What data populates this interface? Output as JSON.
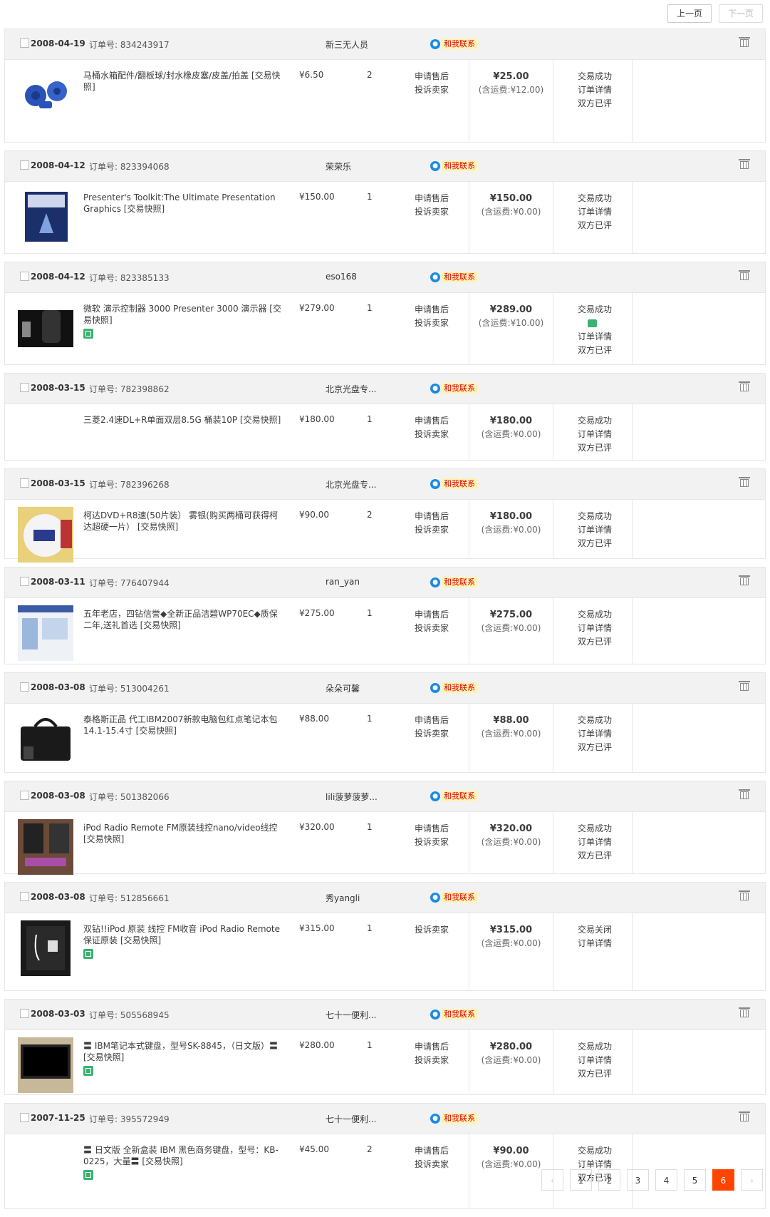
{
  "pager_top": {
    "prev": "上一页",
    "next": "下一页"
  },
  "labels": {
    "order_no": "订单号:",
    "contact": "和我联系",
    "after_sale": "申请售后",
    "complain": "投诉卖家",
    "ship_prefix": "(含运费:",
    "ship_suffix": ")"
  },
  "orders": [
    {
      "date": "2008-04-19",
      "order_no": "834243917",
      "seller": "新三无人员",
      "title": "马桶水箱配件/翻板球/封水橡皮塞/皮盖/拍盖 [交易快照]",
      "badge": false,
      "price": "¥6.50",
      "qty": "2",
      "svc": [
        "申请售后",
        "投诉卖家"
      ],
      "total": "¥25.00",
      "ship": "¥12.00",
      "status": [
        "交易成功",
        "订单详情",
        "双方已评"
      ],
      "chat": false,
      "img": "blue-valve"
    },
    {
      "date": "2008-04-12",
      "order_no": "823394068",
      "seller": "荣荣乐",
      "title": "Presenter's Toolkit:The Ultimate Presentation Graphics [交易快照]",
      "badge": false,
      "price": "¥150.00",
      "qty": "1",
      "svc": [
        "申请售后",
        "投诉卖家"
      ],
      "total": "¥150.00",
      "ship": "¥0.00",
      "status": [
        "交易成功",
        "订单详情",
        "双方已评"
      ],
      "chat": false,
      "img": "software-box"
    },
    {
      "date": "2008-04-12",
      "order_no": "823385133",
      "seller": "eso168",
      "title": "微软 演示控制器 3000 Presenter 3000 演示器 [交易快照]",
      "badge": true,
      "price": "¥279.00",
      "qty": "1",
      "svc": [
        "申请售后",
        "投诉卖家"
      ],
      "total": "¥289.00",
      "ship": "¥10.00",
      "status": [
        "交易成功",
        "订单详情",
        "双方已评"
      ],
      "chat": true,
      "img": "presenter"
    },
    {
      "date": "2008-03-15",
      "order_no": "782398862",
      "seller": "北京光盘专...",
      "title": "三菱2.4速DL+R单面双层8.5G 桶装10P [交易快照]",
      "badge": false,
      "price": "¥180.00",
      "qty": "1",
      "svc": [
        "申请售后",
        "投诉卖家"
      ],
      "total": "¥180.00",
      "ship": "¥0.00",
      "status": [
        "交易成功",
        "订单详情",
        "双方已评"
      ],
      "chat": false,
      "img": "none"
    },
    {
      "date": "2008-03-15",
      "order_no": "782396268",
      "seller": "北京光盘专...",
      "title": "柯达DVD+R8速(50片装） 雾银(购买两桶可获得柯达超硬一片） [交易快照]",
      "badge": false,
      "price": "¥90.00",
      "qty": "2",
      "svc": [
        "申请售后",
        "投诉卖家"
      ],
      "total": "¥180.00",
      "ship": "¥0.00",
      "status": [
        "交易成功",
        "订单详情",
        "双方已评"
      ],
      "chat": false,
      "img": "dvd-spindle"
    },
    {
      "date": "2008-03-11",
      "order_no": "776407944",
      "seller": "ran_yan",
      "title": "五年老店，四钻信誉◆全新正品洁碧WP70EC◆质保二年,送礼首选 [交易快照]",
      "badge": false,
      "price": "¥275.00",
      "qty": "1",
      "svc": [
        "申请售后",
        "投诉卖家"
      ],
      "total": "¥275.00",
      "ship": "¥0.00",
      "status": [
        "交易成功",
        "订单详情",
        "双方已评"
      ],
      "chat": false,
      "img": "flyer"
    },
    {
      "date": "2008-03-08",
      "order_no": "513004261",
      "seller": "朵朵可馨",
      "title": "泰格斯正品 代工IBM2007新款电脑包红点笔记本包 14.1-15.4寸 [交易快照]",
      "badge": false,
      "price": "¥88.00",
      "qty": "1",
      "svc": [
        "申请售后",
        "投诉卖家"
      ],
      "total": "¥88.00",
      "ship": "¥0.00",
      "status": [
        "交易成功",
        "订单详情",
        "双方已评"
      ],
      "chat": false,
      "img": "laptop-bag"
    },
    {
      "date": "2008-03-08",
      "order_no": "501382066",
      "seller": "lili菠萝菠萝...",
      "title": "iPod Radio Remote FM原装线控nano/video线控 [交易快照]",
      "badge": false,
      "price": "¥320.00",
      "qty": "1",
      "svc": [
        "申请售后",
        "投诉卖家"
      ],
      "total": "¥320.00",
      "ship": "¥0.00",
      "status": [
        "交易成功",
        "订单详情",
        "双方已评"
      ],
      "chat": false,
      "img": "ipod-remote"
    },
    {
      "date": "2008-03-08",
      "order_no": "512856661",
      "seller": "秀yangli",
      "title": "双钻!!iPod 原装 线控 FM收音 iPod Radio Remote 保证原装 [交易快照]",
      "badge": true,
      "price": "¥315.00",
      "qty": "1",
      "svc": [
        "投诉卖家"
      ],
      "total": "¥315.00",
      "ship": "¥0.00",
      "status": [
        "交易关闭",
        "订单详情"
      ],
      "chat": false,
      "img": "ipod-box"
    },
    {
      "date": "2008-03-03",
      "order_no": "505568945",
      "seller": "七十一便利...",
      "title": "〓 IBM笔记本式键盘，型号SK-8845，（日文版）〓 [交易快照]",
      "badge": true,
      "price": "¥280.00",
      "qty": "1",
      "svc": [
        "申请售后",
        "投诉卖家"
      ],
      "total": "¥280.00",
      "ship": "¥0.00",
      "status": [
        "交易成功",
        "订单详情",
        "双方已评"
      ],
      "chat": false,
      "img": "keyboard"
    },
    {
      "date": "2007-11-25",
      "order_no": "395572949",
      "seller": "七十一便利...",
      "title": "〓 日文版 全新盒装 IBM 黑色商务键盘，型号：KB-0225，大量〓 [交易快照]",
      "badge": true,
      "price": "¥45.00",
      "qty": "2",
      "svc": [
        "申请售后",
        "投诉卖家"
      ],
      "total": "¥90.00",
      "ship": "¥0.00",
      "status": [
        "交易成功",
        "订单详情",
        "双方已评"
      ],
      "chat": false,
      "img": "none"
    }
  ],
  "pager_bottom": {
    "prev": "‹",
    "pages": [
      "1",
      "2",
      "3",
      "4",
      "5",
      "6"
    ],
    "active": "6",
    "next": "›"
  }
}
